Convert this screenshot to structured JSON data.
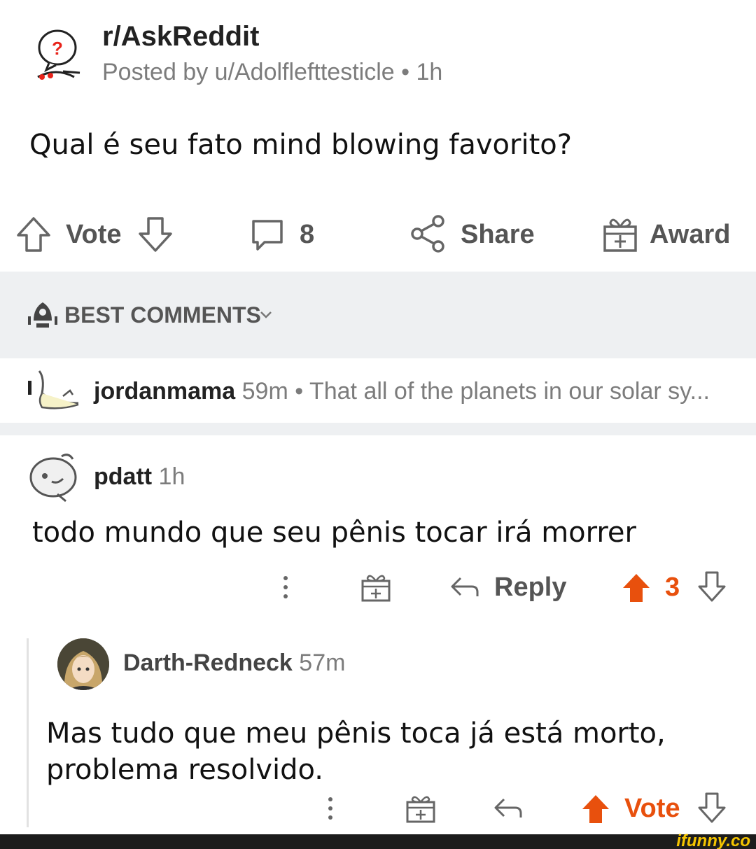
{
  "post": {
    "subreddit": "r/AskReddit",
    "posted_by": "Posted by u/Adolflefttesticle • 1h",
    "title": "Qual é seu fato mind blowing favorito?",
    "actions": {
      "vote_label": "Vote",
      "comment_count": "8",
      "share_label": "Share",
      "award_label": "Award"
    }
  },
  "sort": {
    "label": "BEST COMMENTS"
  },
  "collapsed_comment": {
    "username": "jordanmama",
    "time": "59m",
    "preview": "• That all of the planets in our solar sy..."
  },
  "comments": [
    {
      "username": "pdatt",
      "time": "1h",
      "body": "todo mundo que seu pênis tocar irá morrer",
      "reply_label": "Reply",
      "score": "3"
    },
    {
      "username": "Darth-Redneck",
      "time": "57m",
      "body_line1": "Mas tudo que meu pênis toca já está morto,",
      "body_line2": "problema resolvido.",
      "vote_label": "Vote"
    }
  ],
  "watermark": "ifunny.co",
  "colors": {
    "upvote_orange": "#e8500d",
    "band_gray": "#eef0f2",
    "text_gray": "#7c7c7c"
  }
}
